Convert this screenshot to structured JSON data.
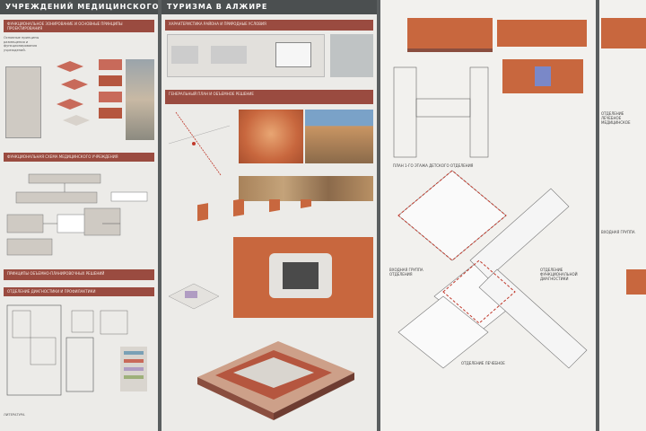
{
  "panel1": {
    "header": "УЧРЕЖДЕНИЙ МЕДИЦИНСКОГО",
    "bar1": "ФУНКЦИОНАЛЬНОЕ ЗОНИРОВАНИЕ И ОСНОВНЫЕ ПРИНЦИПЫ ПРОЕКТИРОВАНИЯ",
    "bar2": "ФУНКЦИОНАЛЬНАЯ СХЕМА МЕДИЦИНСКОГО УЧРЕЖДЕНИЯ",
    "bar3": "ПРИНЦИПЫ ОБЪЕМНО-ПЛАНИРОВОЧНЫХ РЕШЕНИЙ",
    "bar4": "ОТДЕЛЕНИЕ ДИАГНОСТИКИ И ПРОФИЛАКТИКИ",
    "caption": "ЛИТЕРАТУРА"
  },
  "panel2": {
    "header": "ТУРИЗМА В АЛЖИРЕ",
    "bar1": "ХАРАКТЕРИСТИКА РАЙОНА И ПРИРОДНЫЕ УСЛОВИЯ",
    "bar2": "ГЕНЕРАЛЬНЫЙ ПЛАН И ОБЪЕМНОЕ РЕШЕНИЕ"
  },
  "panel3": {
    "label_plan": "ПЛАН 1-ГО ЭТАЖА ДЕТСКОГО ОТДЕЛЕНИЯ",
    "label_left": "ВХОДНАЯ ГРУППА ОТДЕЛЕНИЯ",
    "label_right": "ОТДЕЛЕНИЕ ФУНКЦИОНАЛЬНОЙ ДИАГНОСТИКИ",
    "label_bottom": "ОТДЕЛЕНИЕ ЛЕЧЕБНОЕ"
  },
  "panel4": {
    "label1": "ОТДЕЛЕНИЕ ЛЕЧЕБНОЕ МЕДИЦИНСКОЕ",
    "label2": "ВХОДНАЯ ГРУППА"
  },
  "colors": {
    "accent": "#9a4b40",
    "terracotta": "#c8673e",
    "header": "#4b4f50"
  }
}
